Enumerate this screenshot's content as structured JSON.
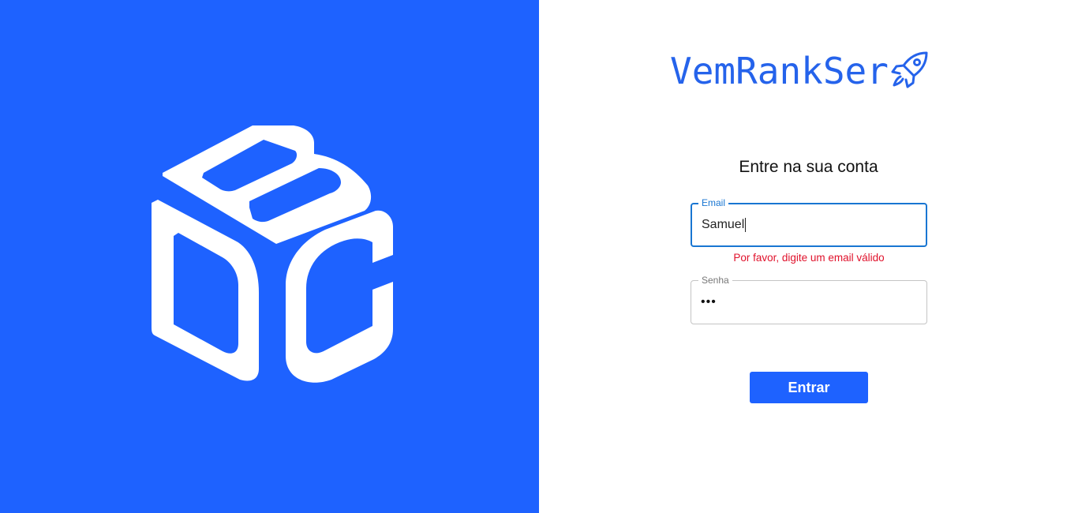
{
  "brand": {
    "name": "VemRankSer",
    "accent_color": "#2563eb",
    "icon": "rocket-icon"
  },
  "left_panel": {
    "background_color": "#1e62ff",
    "logo": "bdc-cube-logo"
  },
  "login": {
    "heading": "Entre na sua conta",
    "email": {
      "label": "Email",
      "value": "Samuel",
      "error": "Por favor, digite um email válido"
    },
    "password": {
      "label": "Senha",
      "value": "•••"
    },
    "submit_label": "Entrar"
  },
  "colors": {
    "error": "#e0112b",
    "focus": "#1976d2",
    "button": "#1e62ff"
  }
}
